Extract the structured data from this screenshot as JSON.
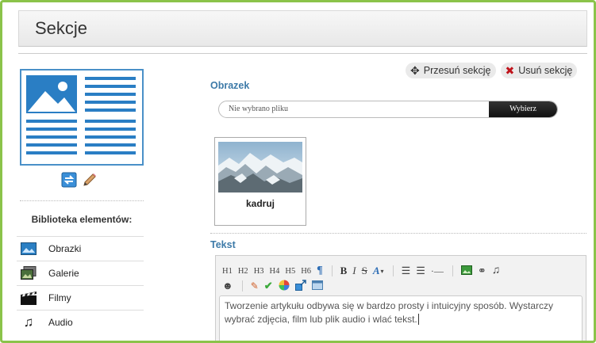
{
  "header": {
    "title": "Sekcje"
  },
  "actions": {
    "move_label": "Przesuń sekcję",
    "delete_label": "Usuń sekcję"
  },
  "library": {
    "title": "Biblioteka elementów:",
    "items": [
      {
        "label": "Obrazki",
        "icon": "picture-icon"
      },
      {
        "label": "Galerie",
        "icon": "gallery-icon"
      },
      {
        "label": "Filmy",
        "icon": "film-clapper-icon"
      },
      {
        "label": "Audio",
        "icon": "music-notes-icon"
      }
    ]
  },
  "image_section": {
    "label": "Obrazek",
    "file_placeholder": "Nie wybrano pliku",
    "choose_button": "Wybierz",
    "crop_label": "kadruj"
  },
  "text_section": {
    "label": "Tekst",
    "toolbar_headings": [
      "H1",
      "H2",
      "H3",
      "H4",
      "H5",
      "H6"
    ],
    "content": "Tworzenie artykułu odbywa się w bardzo prosty i intuicyjny sposób. Wystarczy wybrać zdjęcia, film lub plik audio i wlać tekst."
  },
  "colors": {
    "accent_green": "#8bc34a",
    "label_blue": "#3d7aa8",
    "delete_red": "#c0141c",
    "thumb_blue": "#4a90c8"
  }
}
